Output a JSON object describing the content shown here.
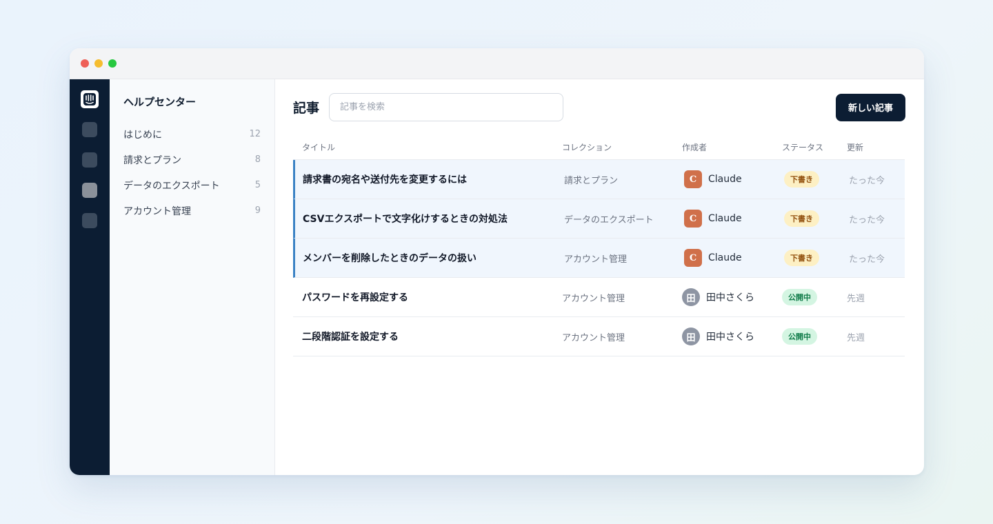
{
  "window": {
    "controls": [
      "close",
      "minimize",
      "maximize"
    ]
  },
  "rail": {
    "logo_icon": "intercom-logo-icon",
    "items": [
      {
        "icon": "nav-square-icon",
        "active": false
      },
      {
        "icon": "nav-square-icon",
        "active": false
      },
      {
        "icon": "nav-square-icon",
        "active": true
      },
      {
        "icon": "nav-square-icon",
        "active": false
      }
    ]
  },
  "sidebar": {
    "title": "ヘルプセンター",
    "items": [
      {
        "label": "はじめに",
        "count": "12"
      },
      {
        "label": "請求とプラン",
        "count": "8"
      },
      {
        "label": "データのエクスポート",
        "count": "5"
      },
      {
        "label": "アカウント管理",
        "count": "9"
      }
    ]
  },
  "main": {
    "title": "記事",
    "search_placeholder": "記事を検索",
    "new_button": "新しい記事"
  },
  "table": {
    "headers": {
      "title": "タイトル",
      "collection": "コレクション",
      "author": "作成者",
      "status": "ステータス",
      "updated": "更新"
    },
    "rows": [
      {
        "title": "請求書の宛名や送付先を変更するには",
        "collection": "請求とプラン",
        "avatar": "C",
        "author": "Claude",
        "status": "下書き",
        "status_type": "draft",
        "updated": "たった今",
        "highlighted": true
      },
      {
        "title": "CSVエクスポートで文字化けするときの対処法",
        "collection": "データのエクスポート",
        "avatar": "C",
        "author": "Claude",
        "status": "下書き",
        "status_type": "draft",
        "updated": "たった今",
        "highlighted": true
      },
      {
        "title": "メンバーを削除したときのデータの扱い",
        "collection": "アカウント管理",
        "avatar": "C",
        "author": "Claude",
        "status": "下書き",
        "status_type": "draft",
        "updated": "たった今",
        "highlighted": true
      },
      {
        "title": "パスワードを再設定する",
        "collection": "アカウント管理",
        "avatar": "田",
        "author": "田中さくら",
        "status": "公開中",
        "status_type": "published",
        "updated": "先週",
        "highlighted": false
      },
      {
        "title": "二段階認証を設定する",
        "collection": "アカウント管理",
        "avatar": "田",
        "author": "田中さくら",
        "status": "公開中",
        "status_type": "published",
        "updated": "先週",
        "highlighted": false
      }
    ]
  },
  "colors": {
    "rail_bg": "#0c1d33",
    "accent": "#3b82c4",
    "claude_avatar": "#d0704a",
    "draft_badge_bg": "#fdf0c4",
    "published_badge_bg": "#d4f5e2"
  }
}
